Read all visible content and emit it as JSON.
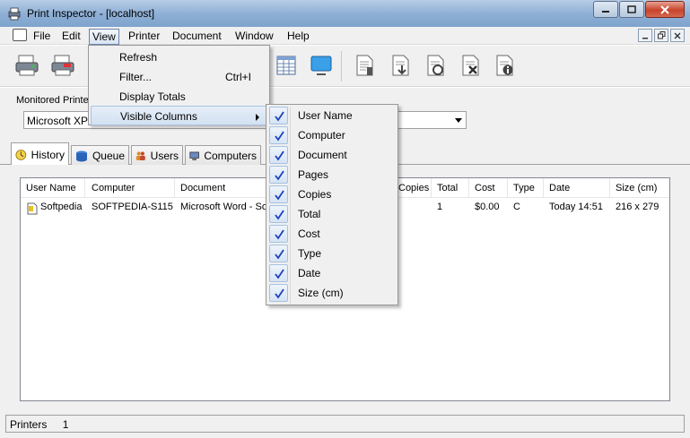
{
  "window": {
    "title": "Print Inspector - [localhost]"
  },
  "menubar": {
    "items": [
      "File",
      "Edit",
      "View",
      "Printer",
      "Document",
      "Window",
      "Help"
    ],
    "active": "View"
  },
  "view_menu": {
    "items": [
      {
        "label": "Refresh",
        "shortcut": ""
      },
      {
        "label": "Filter...",
        "shortcut": "Ctrl+I"
      },
      {
        "label": "Display Totals",
        "shortcut": ""
      },
      {
        "label": "Visible Columns",
        "shortcut": "",
        "submenu": true
      }
    ]
  },
  "visible_columns": {
    "items": [
      "User Name",
      "Computer",
      "Document",
      "Pages",
      "Copies",
      "Total",
      "Cost",
      "Type",
      "Date",
      "Size (cm)"
    ],
    "all_checked": true
  },
  "monitor": {
    "label": "Monitored Printer",
    "selected": "Microsoft XPS"
  },
  "tabs": [
    "History",
    "Queue",
    "Users",
    "Computers"
  ],
  "table": {
    "columns": [
      "User Name",
      "Computer",
      "Document",
      "Copies",
      "Total",
      "Cost",
      "Type",
      "Date",
      "Size (cm)"
    ],
    "rows": [
      {
        "user": "Softpedia",
        "computer": "SOFTPEDIA-S115",
        "document": "Microsoft Word - So",
        "copies": "",
        "total": "1",
        "cost": "$0.00",
        "type": "C",
        "date": "Today 14:51",
        "size": "216 x 279"
      }
    ]
  },
  "status": {
    "label": "Printers",
    "count": "1"
  },
  "colors": {
    "titlebar": "#8fb0d6",
    "close": "#c7432b",
    "check": "#1a3fbf",
    "menu_hover": "#d3e1f2"
  }
}
